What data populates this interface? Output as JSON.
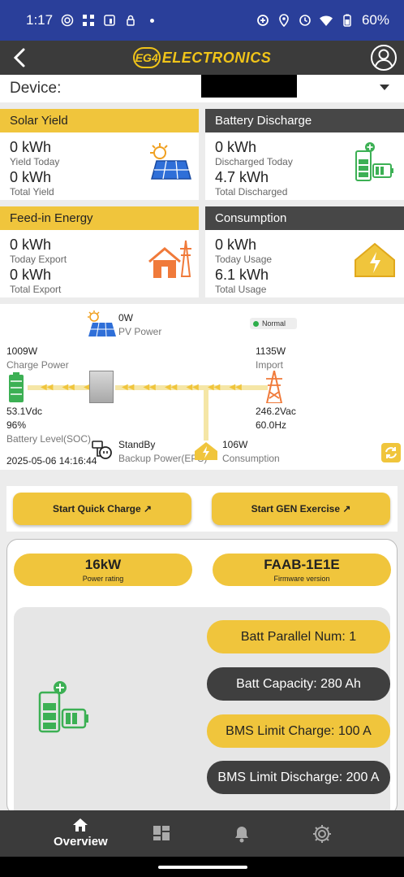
{
  "status_bar": {
    "time": "1:17",
    "battery": "60%"
  },
  "header": {
    "logo_mark": "EG4",
    "logo_text": "ELECTRONICS"
  },
  "device": {
    "label": "Device:"
  },
  "cards": {
    "solar_yield": {
      "title": "Solar Yield",
      "v1": "0 kWh",
      "l1": "Yield Today",
      "v2": "0 kWh",
      "l2": "Total Yield"
    },
    "battery_discharge": {
      "title": "Battery Discharge",
      "v1": "0 kWh",
      "l1": "Discharged Today",
      "v2": "4.7 kWh",
      "l2": "Total Discharged"
    },
    "feed_in": {
      "title": "Feed-in Energy",
      "v1": "0 kWh",
      "l1": "Today Export",
      "v2": "0 kWh",
      "l2": "Total Export"
    },
    "consumption": {
      "title": "Consumption",
      "v1": "0 kWh",
      "l1": "Today Usage",
      "v2": "6.1 kWh",
      "l2": "Total Usage"
    }
  },
  "flow": {
    "pv_power": "0W",
    "pv_label": "PV Power",
    "status": "Normal",
    "charge_power": "1009W",
    "charge_label": "Charge Power",
    "import_power": "1135W",
    "import_label": "Import",
    "battery_voltage": "53.1Vdc",
    "soc": "96%",
    "soc_label": "Battery Level(SOC)",
    "grid_voltage": "246.2Vac",
    "grid_freq": "60.0Hz",
    "backup_state": "StandBy",
    "backup_label": "Backup Power(EPS)",
    "consumption_power": "106W",
    "consumption_label": "Consumption",
    "timestamp": "2025-05-06 14:16:44"
  },
  "actions": {
    "quick_charge": "Start Quick Charge ↗",
    "gen_exercise": "Start GEN Exercise ↗"
  },
  "info": {
    "power_rating": "16kW",
    "power_rating_label": "Power rating",
    "firmware": "FAAB-1E1E",
    "firmware_label": "Firmware version",
    "batt_parallel": "Batt Parallel Num: 1",
    "batt_capacity": "Batt Capacity: 280 Ah",
    "bms_charge": "BMS Limit Charge: 100 A",
    "bms_discharge": "BMS Limit Discharge: 200 A"
  },
  "nav": {
    "overview": "Overview"
  },
  "colors": {
    "accent": "#f0c53c",
    "dark": "#3b3b3b",
    "status_bar": "#2a3f9a",
    "green": "#3cb054",
    "orange": "#f07a3a"
  }
}
